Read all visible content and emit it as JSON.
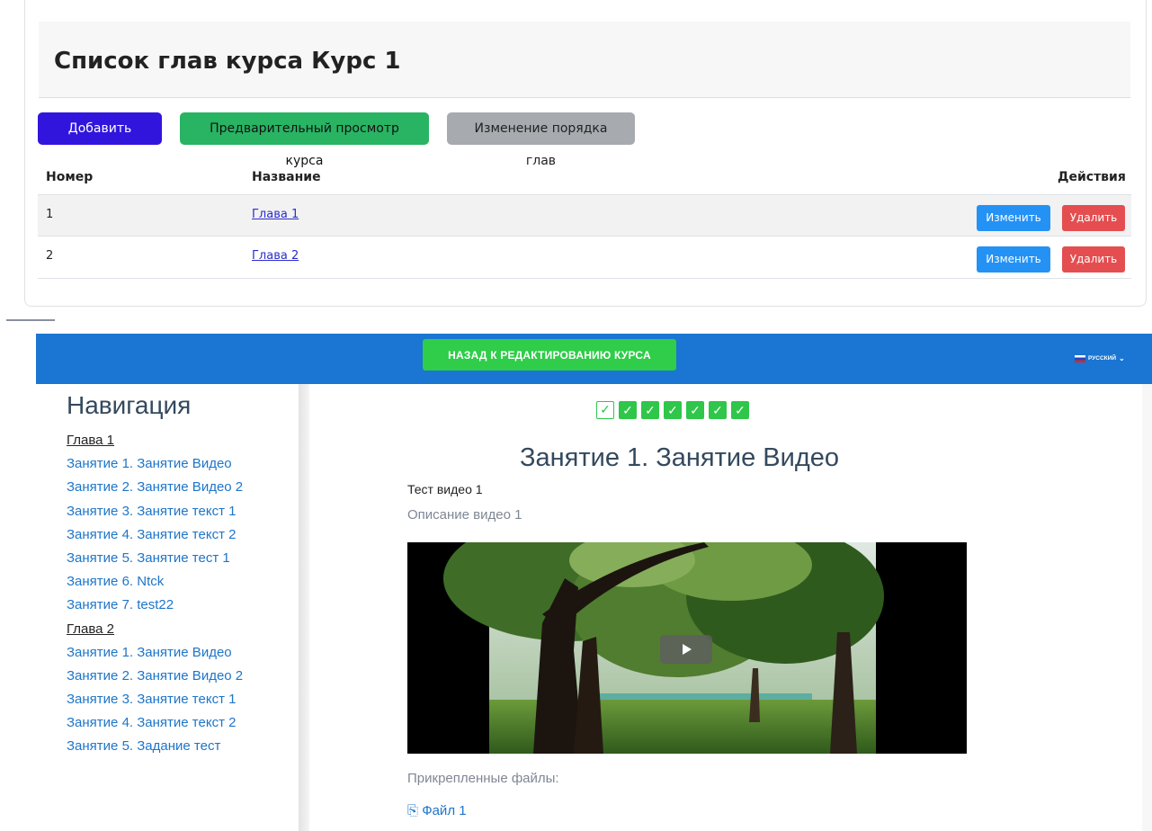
{
  "admin": {
    "title": "Список глав курса Курс 1",
    "buttons": {
      "add_chapter": "Добавить главу",
      "preview": "Предварительный просмотр курса",
      "reorder": "Изменение порядка глав"
    },
    "table": {
      "headers": {
        "number": "Номер",
        "name": "Название",
        "actions": "Действия"
      },
      "rows": [
        {
          "number": "1",
          "name": "Глава 1",
          "edit": "Изменить",
          "delete": "Удалить"
        },
        {
          "number": "2",
          "name": "Глава 2",
          "edit": "Изменить",
          "delete": "Удалить"
        }
      ]
    }
  },
  "preview": {
    "back_button": "НАЗАД К РЕДАКТИРОВАНИЮ КУРСА",
    "language": "РУССКИЙ",
    "nav": {
      "title": "Навигация",
      "items": [
        {
          "type": "chapter",
          "label": "Глава 1"
        },
        {
          "type": "lesson",
          "label": "Занятие 1. Занятие Видео"
        },
        {
          "type": "lesson",
          "label": "Занятие 2. Занятие Видео 2"
        },
        {
          "type": "lesson",
          "label": "Занятие 3. Занятие текст 1"
        },
        {
          "type": "lesson",
          "label": "Занятие 4. Занятие текст 2"
        },
        {
          "type": "lesson",
          "label": "Занятие 5. Занятие тест 1"
        },
        {
          "type": "lesson",
          "label": "Занятие 6. Ntck"
        },
        {
          "type": "lesson",
          "label": "Занятие 7. test22"
        },
        {
          "type": "chapter",
          "label": "Глава 2"
        },
        {
          "type": "lesson",
          "label": "Занятие 1. Занятие Видео"
        },
        {
          "type": "lesson",
          "label": "Занятие 2. Занятие Видео 2"
        },
        {
          "type": "lesson",
          "label": "Занятие 3. Занятие текст 1"
        },
        {
          "type": "lesson",
          "label": "Занятие 4. Занятие текст 2"
        },
        {
          "type": "lesson",
          "label": "Занятие 5. Задание тест"
        }
      ]
    },
    "progress": {
      "total": 7,
      "current_index": 0,
      "completed": 7
    },
    "lesson": {
      "title": "Занятие 1. Занятие Видео",
      "video_title": "Тест видео 1",
      "video_description": "Описание видео 1",
      "attachments_label": "Прикрепленные файлы:",
      "file": "Файл 1"
    },
    "colors": {
      "header": "#1a76d2",
      "accent": "#2fcd49",
      "link": "#1d75c9"
    }
  }
}
